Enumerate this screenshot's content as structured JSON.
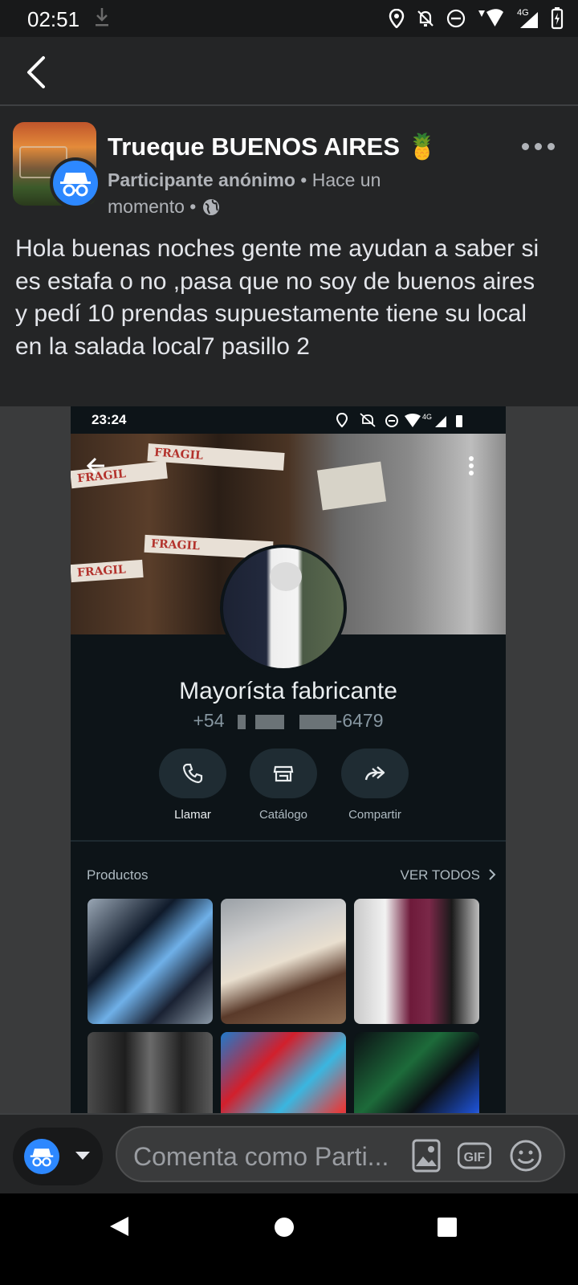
{
  "status_bar": {
    "time": "02:51",
    "network": "4G"
  },
  "post": {
    "group_name": "Trueque  BUENOS AIRES 🍍",
    "author": "Participante anónimo",
    "separator": "•",
    "time_ago": "Hace un momento",
    "privacy_icon": "globe-icon",
    "text": "Hola buenas noches gente me ayudan a saber si es estafa o no ,pasa que no soy de buenos aires y pedí 10 prendas supuestamente tiene su local en la salada local7 pasillo 2"
  },
  "embedded_screenshot": {
    "time": "23:24",
    "network": "4G",
    "tape_text": "FRAGIL",
    "contact_name": "Mayorísta fabricante",
    "phone_prefix": "+54",
    "phone_suffix": "-6479",
    "actions": [
      {
        "label": "Llamar",
        "icon": "phone-icon"
      },
      {
        "label": "Catálogo",
        "icon": "store-icon"
      },
      {
        "label": "Compartir",
        "icon": "share-icon"
      }
    ],
    "products_title": "Productos",
    "see_all": "VER TODOS"
  },
  "comment_bar": {
    "placeholder": "Comenta como Parti...",
    "gif_label": "GIF"
  },
  "colors": {
    "background": "#242526",
    "accent": "#2d88ff",
    "text_primary": "#e4e6eb",
    "text_secondary": "#b0b3b8"
  }
}
